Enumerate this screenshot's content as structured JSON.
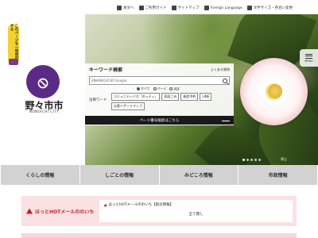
{
  "topbar": {
    "items": [
      {
        "label": "本文へ"
      },
      {
        "label": "ご利用ガイド"
      },
      {
        "label": "サイトマップ"
      },
      {
        "label": "Foreign Language"
      },
      {
        "label": "文字サイズ・色合い変更"
      }
    ]
  },
  "left_tag": {
    "text": "このページを一時保存する"
  },
  "logo": {
    "name": "野々市市",
    "sub": "NONOICHI CITY"
  },
  "menu": {
    "label": "MENU"
  },
  "search": {
    "title": "キーワード検索",
    "hint": "よくある質問",
    "placeholder": "ENHANCED BY Google",
    "radios": [
      {
        "label": "すべて",
        "selected": true
      },
      {
        "label": "ページ",
        "selected": false
      },
      {
        "label": "PDF",
        "selected": false
      }
    ],
    "keywords_label": "注目ワード",
    "keywords": [
      "コミュニティバス「のっティ」",
      "家庭ごみ",
      "施設予約",
      "LINE",
      "水害ハザードマップ"
    ],
    "page_number_button": "ページ番号検索はこちら"
  },
  "slider": {
    "dots": 5,
    "active": 0,
    "control": "停止"
  },
  "nav": {
    "items": [
      {
        "label": "くらしの情報"
      },
      {
        "label": "しごとの情報"
      },
      {
        "label": "みどころ情報"
      },
      {
        "label": "市政情報"
      }
    ]
  },
  "notice": {
    "title": "ほっとHOTメールののいち",
    "items": [
      {
        "text": "ほっとHOTメールののいち【防災情報】"
      }
    ],
    "all_label": "全て閲し"
  },
  "colors": {
    "accent": "#5b2a86",
    "alert": "#c21f2d",
    "tag": "#f2d232"
  }
}
